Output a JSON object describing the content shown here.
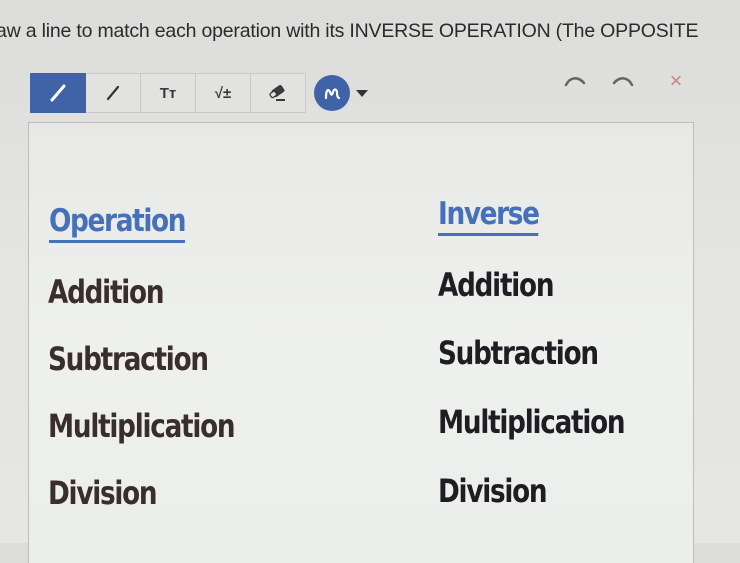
{
  "instruction": "aw a line to match each operation with its INVERSE OPERATION (The OPPOSITE",
  "toolbar": {
    "tools": [
      {
        "name": "pen",
        "icon": "pen-icon",
        "active": true
      },
      {
        "name": "line",
        "icon": "line-icon",
        "active": false
      },
      {
        "name": "text",
        "label": "Tт",
        "icon": "text-size-icon",
        "active": false
      },
      {
        "name": "math",
        "label": "√±",
        "icon": "math-icon",
        "active": false
      },
      {
        "name": "eraser",
        "icon": "eraser-icon",
        "active": false
      }
    ],
    "color": {
      "value": "#3f63a6",
      "icon": "scribble-icon"
    },
    "undo_icon": "undo-icon",
    "redo_icon": "redo-icon",
    "close_label": "×"
  },
  "worksheet": {
    "left_header": "Operation",
    "right_header": "Inverse",
    "left_items": [
      "Addition",
      "Subtraction",
      "Multiplication",
      "Division"
    ],
    "right_items": [
      "Addition",
      "Subtraction",
      "Multiplication",
      "Division"
    ],
    "header_color": "#4670b8"
  }
}
